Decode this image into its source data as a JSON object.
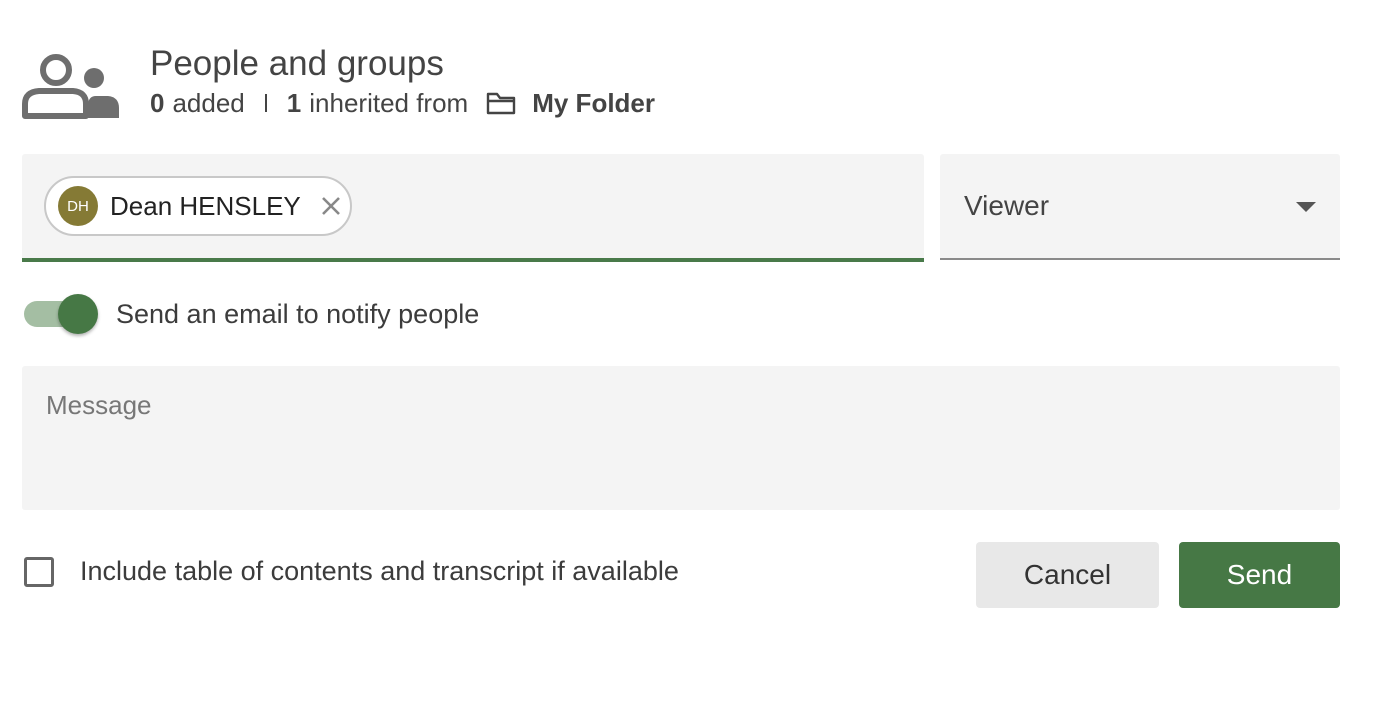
{
  "header": {
    "title": "People and groups",
    "added_count": "0",
    "added_label": "added",
    "inherited_count": "1",
    "inherited_label": "inherited from",
    "folder_name": "My Folder",
    "icon": "people-icon",
    "folder_icon": "folder-icon"
  },
  "recipients": {
    "chips": [
      {
        "initials": "DH",
        "name": "Dean HENSLEY",
        "avatar_color": "#857a35"
      }
    ]
  },
  "role": {
    "selected": "Viewer"
  },
  "notify": {
    "label": "Send an email to notify people",
    "enabled": true
  },
  "message": {
    "placeholder": "Message",
    "value": ""
  },
  "include_toc": {
    "label": "Include table of contents and transcript if available",
    "checked": false
  },
  "buttons": {
    "cancel_label": "Cancel",
    "send_label": "Send"
  },
  "colors": {
    "accent": "#467845",
    "accent_light": "#a4bea3",
    "field_bg": "#f4f4f4"
  }
}
